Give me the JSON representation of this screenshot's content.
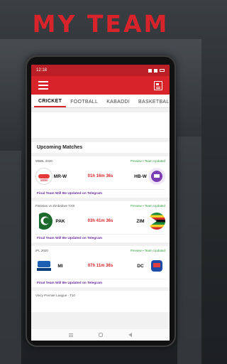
{
  "promo": {
    "title": "MY TEAM"
  },
  "status_bar": {
    "time": "12:18"
  },
  "tabs": [
    {
      "label": "CRICKET"
    },
    {
      "label": "FOOTBALL"
    },
    {
      "label": "KABADDI"
    },
    {
      "label": "BASKETBALL"
    }
  ],
  "section_title": "Upcoming Matches",
  "matches": [
    {
      "league": "WBBL 2020",
      "status": "Preview • Team Updated",
      "team1": "MR-W",
      "team2": "HB-W",
      "countdown": "01h 16m 36s",
      "footer": "Final Team Will Be Updated on Telegram",
      "logo1": "melbourne-renegades-logo",
      "logo2": "hobart-hurricanes-logo"
    },
    {
      "league": "Pakistan vs Zimbabwe T20I",
      "status": "Preview • Team Updated",
      "team1": "PAK",
      "team2": "ZIM",
      "countdown": "03h 41m 36s",
      "footer": "Final Team Will Be Updated on Telegram",
      "logo1": "pakistan-flag",
      "logo2": "zimbabwe-flag"
    },
    {
      "league": "IPL 2020",
      "status": "Preview • Team Updated",
      "team1": "MI",
      "team2": "DC",
      "countdown": "07h 11m 36s",
      "footer": "Final Team Will Be Updated on Telegram",
      "logo1": "mumbai-indians-logo",
      "logo2": "delhi-capitals-logo"
    },
    {
      "league": "Vincy Premier League - T10"
    }
  ],
  "colors": {
    "brand_red": "#d8232a",
    "status_green": "#2e9e3a",
    "telegram_purple": "#6a2c9c"
  }
}
